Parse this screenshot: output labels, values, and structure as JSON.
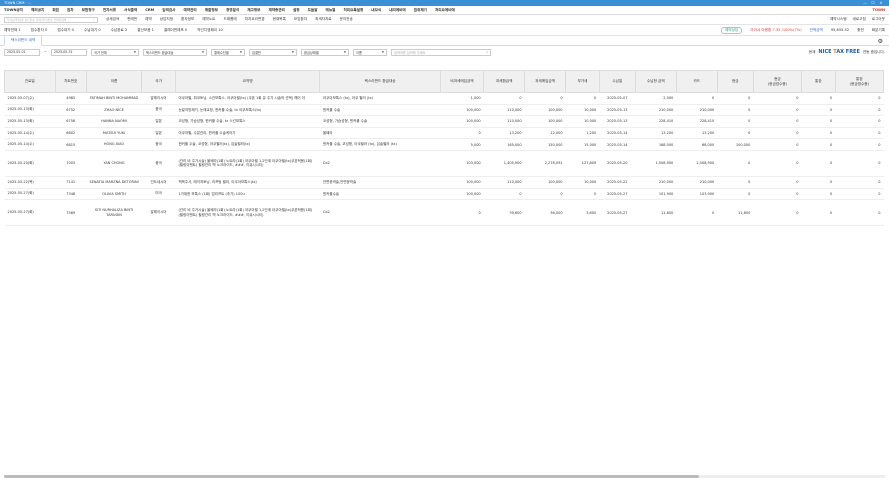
{
  "window": {
    "title": "TOWN CRM · ...",
    "min": "—",
    "max": "☐",
    "close": "✕"
  },
  "menu": {
    "items": [
      "TOWN공지",
      "해외공지",
      "회원",
      "원차",
      "보험청구",
      "전자서류",
      "서식출력",
      "CRM",
      "입력검사",
      "예약관리",
      "매출정보",
      "경영분석",
      "재고정보",
      "재약총관리",
      "설정",
      "도움말",
      "메뉴얼",
      "처리요특설정",
      "내모식",
      "내리에비에",
      "원취제기",
      "처리요에비에"
    ],
    "brand": "TOWN"
  },
  "sub": {
    "search_placeholder": "투자(모바일)명, 차트번호, 환자(주민)번호, 연락처검색",
    "items": [
      "상세검색",
      "판매번",
      "예약",
      "상담지정",
      "환자정보",
      "예약노트",
      "드래롭레",
      "처치요리변경",
      "현재목록",
      "모임환자",
      "최세자치료",
      "문자전송"
    ],
    "right": [
      "예약시스템",
      "새로고침",
      "로그아웃"
    ]
  },
  "counts": {
    "items": [
      "예약전체 1",
      "접수환자 0",
      "접수대기 0",
      "수납대기 0",
      "수납완료 2",
      "결산모음 1",
      "클레이먼레포 0",
      "약선디엠패이 10"
    ],
    "pill": "예약상담",
    "bal": "아이샤 야용환 7.35 /100%(7%)",
    "won": "잔액금액",
    "won_val": "95,855.52",
    "won_btns": [
      "충전",
      "화분기록"
    ]
  },
  "tab": {
    "label": "텍스리펀드 내역"
  },
  "filters": {
    "from": "2025-05-01",
    "to": "2025-05-31",
    "f1": "국가 전체",
    "f2": "텍스리펀드 환급대상",
    "f3": "결제수단별",
    "f4": "입결반",
    "f5": "환급상태별",
    "f6": "이름",
    "search_placeholder": "검색어를 입력해 주세요",
    "nice_text": "현재",
    "nice_suffix": "연동 중입니다."
  },
  "columns": [
    "진료일",
    "차트번호",
    "이름",
    "국가",
    "요약명",
    "텍스리펀드 환급대상",
    "비과세매입금액",
    "과세환급액",
    "과세매입금액",
    "부가세",
    "수납일",
    "수납한 금액",
    "카드",
    "현금",
    "현금\n(현금영수증)",
    "통장",
    "통장\n(현금영수증)"
  ],
  "rows": [
    [
      "2025-05-07(수)",
      "4985",
      "FATIMAH BINTI MOHAMMAD",
      "말레이시아",
      "아쿠아필, 피코토닝, 스킨보톡스, 아쿠아필(tx) (쿠폰 1회 유 주가 시술의 선택) 헤어 아",
      "아쿠아보톡스 (tx), 아쿠 필러 (tx)",
      "1,000",
      "0",
      "0",
      "0",
      "2025-05-07",
      "2,000",
      "0",
      "0",
      "0",
      "0",
      "0"
    ],
    [
      "2025-05-13(화)",
      "6752",
      "ZHAO NICE",
      "중국",
      "눈밑지방제거, 눈매교정, 윈커플 수술, tx 아쿠보톡스(tx)",
      "윈커플 수술",
      "100,000",
      "110,000",
      "100,000",
      "10,000",
      "2025-05-13",
      "210,000",
      "210,000",
      "0",
      "0",
      "0",
      "0"
    ],
    [
      "2025-05-13(화)",
      "6758",
      "HANNA NAOMI",
      "일본",
      "코성형, 가슴성형, 윈커플 수술, tx 스킨보톡스",
      "코성형, 가슴성형, 윈커플 수술",
      "100,000",
      "110,000",
      "100,000",
      "10,000",
      "2025-05-13",
      "228,410",
      "228,410",
      "0",
      "0",
      "0",
      "0"
    ],
    [
      "2025-05-14(수)",
      "6802",
      "MATSUI YUKI",
      "일본",
      "아쿠아필, 수분관리, 윈커플 수술케어기",
      "올페라",
      "0",
      "13,200",
      "12,000",
      "1,200",
      "2025-05-14",
      "13,200",
      "13,200",
      "0",
      "0",
      "0",
      "0"
    ],
    [
      "2025-05-14(수)",
      "6815",
      "HONG XIAO",
      "중국",
      "윈커플 수술, 코성형, 아쿠필러(tx), 입술필러(tx)",
      "윈커플 수술, 코성형, 아쿠필러 (tx), 입술필러 (tx)",
      "5,000",
      "165,000",
      "150,000",
      "15,000",
      "2025-05-14",
      "168,000",
      "68,000",
      "100,000",
      "0",
      "0",
      "0"
    ],
    [
      "2025-05-20(화)",
      "7003",
      "YAN CHONG",
      "중국",
      "(관리 비 주가시술) 울쎄라(1회) 노트라(1회) 아쿠아필 1,2단계 아쿠아필(tx)쿠폰적용(1회) (필링이벤트) 필링관리 맥 노크라이드, ###, 이큐시시티)",
      "Co2",
      "103,000",
      "1,405,900",
      "2,278,091",
      "127,809",
      "2025-05-20",
      "1,508,900",
      "2,508,900",
      "0",
      "0",
      "0",
      "0"
    ],
    [
      "2025-05-22(목)",
      "7141",
      "SENATIA MARZNA DETORINI",
      "인도네시아",
      "백옥주사, 레이저토닝, 리프팅 필러, 아쿠아보톡스(tx)",
      "안면윤곽술,안면윤곽술",
      "100,000",
      "110,000",
      "100,000",
      "10,000",
      "2025-05-22",
      "210,000",
      "210,000",
      "0",
      "0",
      "0",
      "0"
    ],
    [
      "2025-05-27(화)",
      "7348",
      "OLIVIA SMITH",
      "미국",
      "1가위한 보톡스 (1회) 업리프트 (추가) 100u",
      "윈커플수술",
      "100,000",
      "0",
      "0",
      "0",
      "2025-05-27",
      "101,900",
      "103,900",
      "0",
      "0",
      "0",
      "0"
    ],
    [
      "2025-05-27(화)",
      "7569",
      "SITI NURHALIZA BINTI TARUDIN",
      "말레이시아",
      "(관리 비 주가시술) 울쎄라(1회) 노트라(1회) 아쿠아필 1,2단계 아쿠아필(tx)쿠폰적용(1회) (필링이벤트) 필링관리 맥 노크라이드, ###, 이큐시시티)",
      "Co2",
      "0",
      "39,600",
      "36,000",
      "3,600",
      "2025-05-27",
      "11,800",
      "0",
      "11,800",
      "0",
      "0",
      "0"
    ]
  ]
}
